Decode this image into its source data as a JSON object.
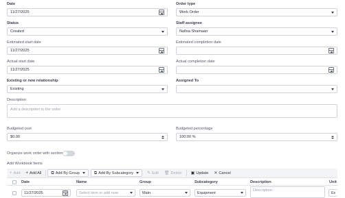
{
  "form": {
    "date": {
      "label": "Date",
      "value": "11/27/2025"
    },
    "order_type": {
      "label": "Order type",
      "value": "Work Order"
    },
    "status": {
      "label": "Status",
      "value": "Created"
    },
    "staff_assignee": {
      "label": "Staff assignee",
      "value": "Nafisa Shamaan"
    },
    "estimated_start_date": {
      "label": "Estimated start date",
      "value": "11/27/2025"
    },
    "estimated_completion_date": {
      "label": "Estimated completion date",
      "value": ""
    },
    "actual_start_date": {
      "label": "Actual start date",
      "value": "11/27/2025"
    },
    "actual_completion_date": {
      "label": "Actual completion date",
      "value": ""
    },
    "relationship": {
      "label": "Existing or new relationship",
      "value": "Existing"
    },
    "assigned_to": {
      "label": "Assigned To",
      "value": ""
    },
    "description": {
      "label": "Description",
      "placeholder": "Add a description to the order"
    },
    "budgeted_cost": {
      "label": "Budgeted cost",
      "value": "$0.00"
    },
    "budgeted_percentage": {
      "label": "Budgeted percentage",
      "value": "100.00 %"
    },
    "organize_sections": {
      "label": "Organize work order with sections",
      "on": false
    },
    "workbook_items_label": "Add Workbook Items"
  },
  "toolbar": {
    "add": "Add",
    "add_all": "Add All",
    "add_by_group": "Add By Group",
    "add_by_subcategory": "Add By Subcategory",
    "edit": "Edit",
    "delete": "Delete",
    "update": "Update",
    "cancel": "Cancel"
  },
  "grid": {
    "columns": [
      "Date",
      "Name",
      "Group",
      "Subcategory",
      "Description",
      "Unit"
    ],
    "row": {
      "date": "11/27/2025",
      "name_placeholder": "Select item or add new",
      "group": "Main",
      "subcategory": "Equipment",
      "description_placeholder": "Description",
      "unit": "Ea"
    }
  },
  "icons": [
    "calendar-icon",
    "chevron-down-icon",
    "spinner-icon",
    "plus-icon",
    "layers-icon",
    "pencil-icon",
    "trash-icon",
    "save-icon",
    "close-icon"
  ]
}
